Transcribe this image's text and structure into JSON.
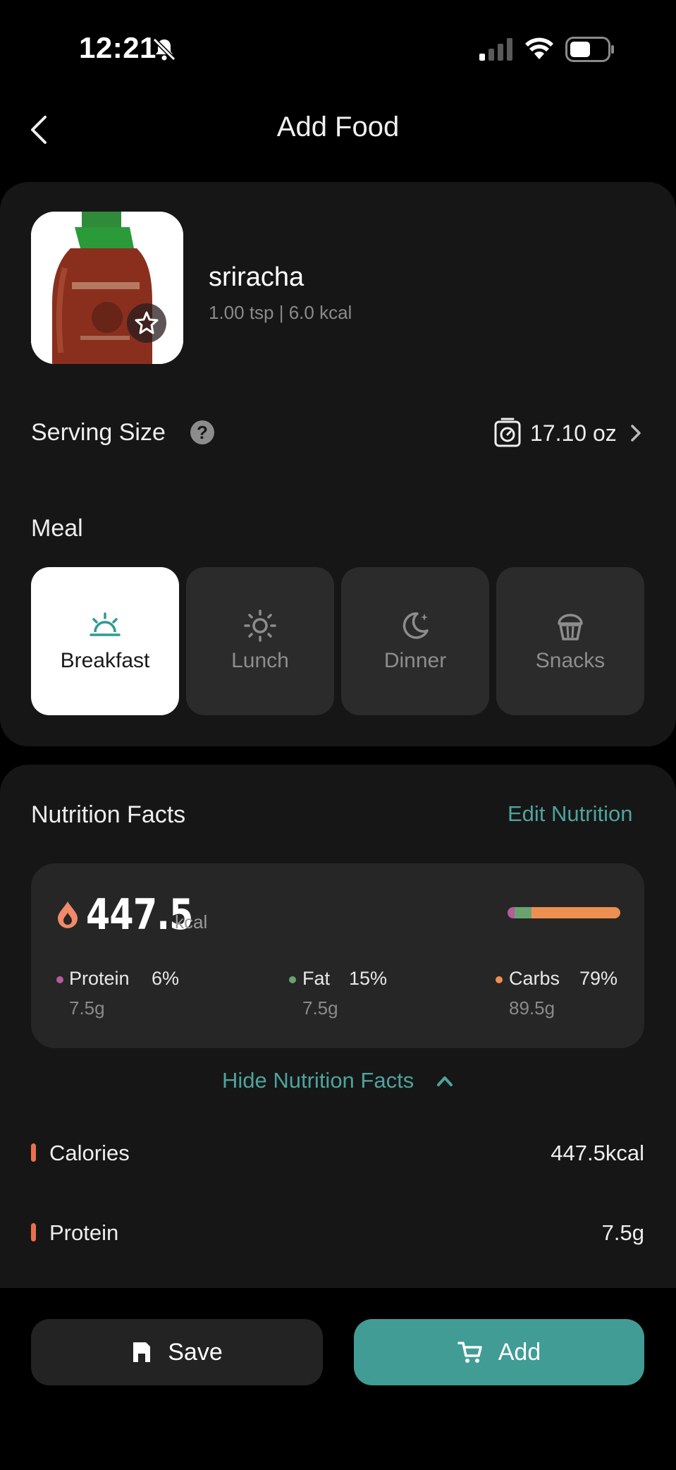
{
  "status_bar": {
    "time": "12:21"
  },
  "header": {
    "title": "Add Food"
  },
  "food": {
    "name": "sriracha",
    "subtitle": "1.00 tsp | 6.0 kcal"
  },
  "serving": {
    "label": "Serving Size",
    "help": "?",
    "value": "17.10 oz"
  },
  "meal": {
    "label": "Meal",
    "options": [
      {
        "label": "Breakfast",
        "icon": "sunrise-icon",
        "selected": true
      },
      {
        "label": "Lunch",
        "icon": "sun-icon",
        "selected": false
      },
      {
        "label": "Dinner",
        "icon": "moon-icon",
        "selected": false
      },
      {
        "label": "Snacks",
        "icon": "cupcake-icon",
        "selected": false
      }
    ]
  },
  "nutrition": {
    "title": "Nutrition Facts",
    "edit_label": "Edit Nutrition",
    "calories": "447.5",
    "calories_unit": "kcal",
    "macros": [
      {
        "name": "Protein",
        "percent": "6%",
        "grams": "7.5g",
        "color": "#b45c9c",
        "fraction": 0.06
      },
      {
        "name": "Fat",
        "percent": "15%",
        "grams": "7.5g",
        "color": "#6aa36f",
        "fraction": 0.15
      },
      {
        "name": "Carbs",
        "percent": "79%",
        "grams": "89.5g",
        "color": "#ee8f52",
        "fraction": 0.79
      }
    ],
    "hide_label": "Hide Nutrition Facts",
    "rows": [
      {
        "label": "Calories",
        "value": "447.5kcal"
      },
      {
        "label": "Protein",
        "value": "7.5g"
      }
    ]
  },
  "actions": {
    "save_label": "Save",
    "add_label": "Add"
  },
  "colors": {
    "accent": "#419c96",
    "accent_text": "#4ea39b",
    "marker": "#e8704f"
  }
}
